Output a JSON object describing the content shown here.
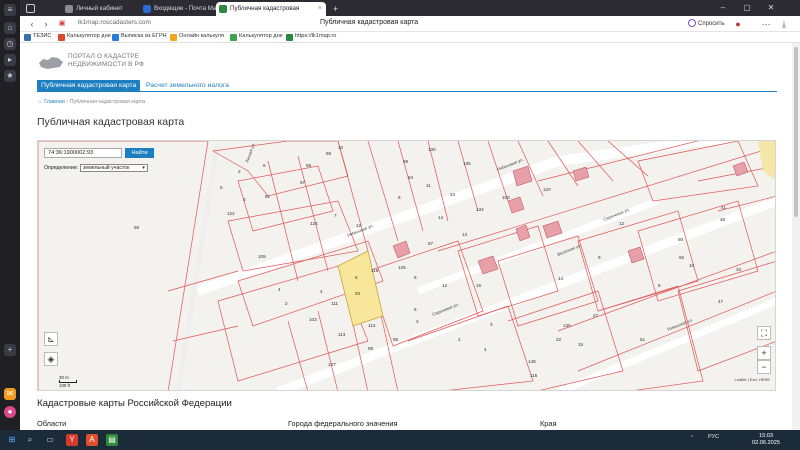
{
  "browser": {
    "tabs": [
      {
        "label": "Личный кабинет",
        "color": "#8a8a92"
      },
      {
        "label": "Входящие - Почта Mail",
        "color": "#2a6bd6"
      },
      {
        "label": "Публичная кадастровая",
        "color": "#2b8a3e"
      }
    ],
    "url": "lk1map.roscadasters.com",
    "page_title": "Публичная кадастровая карта",
    "ask_label": "Спросить",
    "bookmarks": [
      {
        "label": "ТЕЗИС",
        "color": "#3a6fb0"
      },
      {
        "label": "Калькулятор дне",
        "color": "#d84a2b"
      },
      {
        "label": "Выписка из ЕГРН",
        "color": "#2b7bd8"
      },
      {
        "label": "Онлайн калькуля",
        "color": "#f0a81d"
      },
      {
        "label": "Калькулятор дне",
        "color": "#3fa34d"
      },
      {
        "label": "https://lk1map.ro",
        "color": "#2b8a3e"
      }
    ]
  },
  "site": {
    "logo_line1": "ПОРТАЛ О КАДАСТРЕ",
    "logo_line2": "НЕДВИЖИМОСТИ В РФ",
    "nav_active": "Публичная кадастровая карта",
    "nav_link": "Расчет земельного налога",
    "breadcrumb_home": "Главная",
    "breadcrumb_current": "Публичная кадастровая карта",
    "heading": "Публичная кадастровая карта"
  },
  "map": {
    "search_value": "74:36:1900002:93",
    "find_label": "Найти",
    "definition_label": "Определение:",
    "definition_value": "земельный участок",
    "zoom_in": "+",
    "zoom_out": "−",
    "scale_top": "30 m",
    "scale_bottom": "100 ft",
    "attribution": "Leaflet | Esri, HERE",
    "street_labels": [
      "Рябиновая ул.",
      "Сиреневая ул.",
      "Весенняя ул.",
      "Лесная ул.",
      "Сиреневая ул.",
      "Ровенская ул.",
      "Рябиновая ул."
    ],
    "parcel_labels": [
      "10",
      "58",
      "59",
      "99",
      "130",
      "84",
      "11",
      "2",
      "6",
      "97",
      "5",
      "3",
      "7",
      "81",
      "135",
      "122",
      "124",
      "7",
      "12",
      "24",
      "8",
      "14",
      "134",
      "100",
      "120",
      "13",
      "109",
      "125",
      "118",
      "112",
      "115",
      "119",
      "103",
      "111",
      "113",
      "127",
      "127",
      "98",
      "95",
      "9",
      "4",
      "6",
      "8",
      "2",
      "5",
      "3",
      "12",
      "16",
      "14",
      "135",
      "27",
      "22",
      "148",
      "115",
      "51",
      "66",
      "10",
      "8",
      "47",
      "48",
      "50",
      "41",
      "34",
      "2",
      "3",
      "4",
      "15",
      "9",
      "12"
    ],
    "selected_parcel": "6",
    "selected_sub": "93",
    "selected_color": "#f8e79a"
  },
  "section": {
    "title": "Кадастровые карты Российской Федерации",
    "col1": "Области",
    "col2": "Города федерального значения",
    "col3": "Края"
  },
  "taskbar": {
    "lang": "РУС",
    "time": "15:03",
    "date": "02.06.2025"
  }
}
